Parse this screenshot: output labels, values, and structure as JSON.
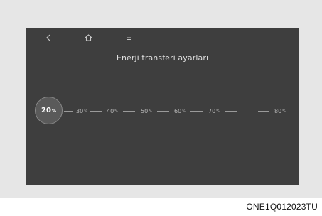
{
  "header": {
    "back_icon": "back-arrow-icon",
    "home_icon": "home-icon",
    "menu_icon": "menu-icon",
    "title": "Enerji transferi ayarları"
  },
  "slider": {
    "selected_value": "20",
    "steps": [
      {
        "value": "20",
        "unit": "%",
        "selected": true
      },
      {
        "value": "30",
        "unit": "%",
        "selected": false
      },
      {
        "value": "40",
        "unit": "%",
        "selected": false
      },
      {
        "value": "50",
        "unit": "%",
        "selected": false
      },
      {
        "value": "60",
        "unit": "%",
        "selected": false
      },
      {
        "value": "70",
        "unit": "%",
        "selected": false
      },
      {
        "value": "80",
        "unit": "%",
        "selected": false
      }
    ]
  },
  "caption": "ONE1Q012023TU"
}
